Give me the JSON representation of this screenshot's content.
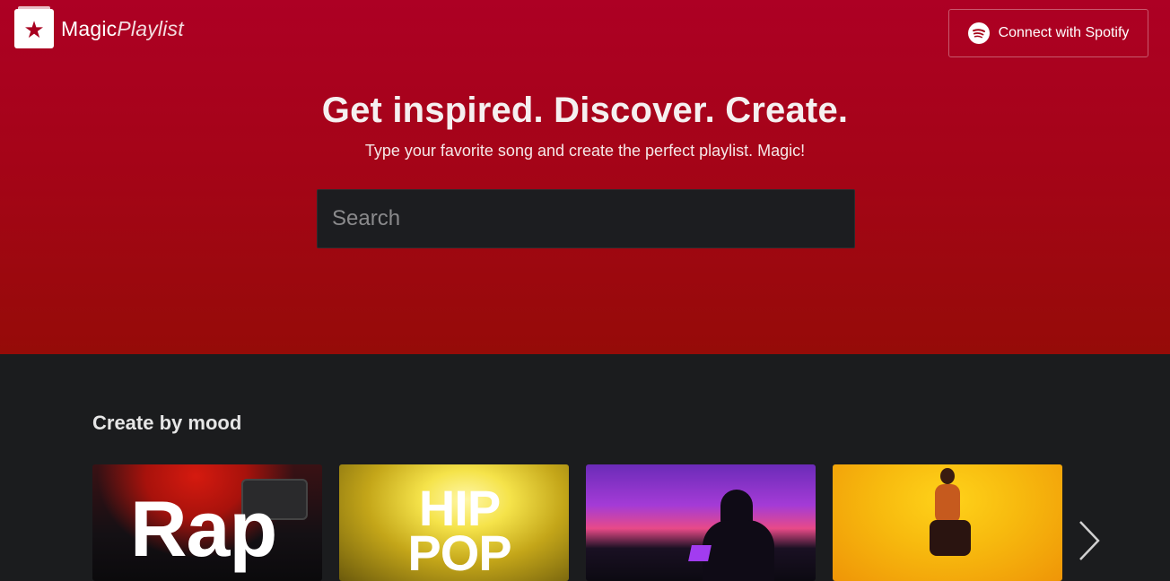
{
  "header": {
    "logo_text_bold": "Magic",
    "logo_text_light": "Playlist",
    "spotify_button_label": "Connect with Spotify"
  },
  "hero": {
    "headline": "Get inspired. Discover. Create.",
    "subheadline": "Type your favorite song and create the perfect playlist. Magic!",
    "search_placeholder": "Search"
  },
  "mood_section": {
    "title": "Create by mood",
    "cards": [
      {
        "label": "Rap"
      },
      {
        "label_line1": "HIP",
        "label_line2": "POP"
      },
      {
        "label": ""
      },
      {
        "label": ""
      }
    ],
    "next_icon": "chevron-right-icon"
  },
  "colors": {
    "hero_top": "#ad0024",
    "hero_bottom": "#960b08",
    "page_bg": "#1b1c1e",
    "search_bg": "#1c1d20"
  }
}
